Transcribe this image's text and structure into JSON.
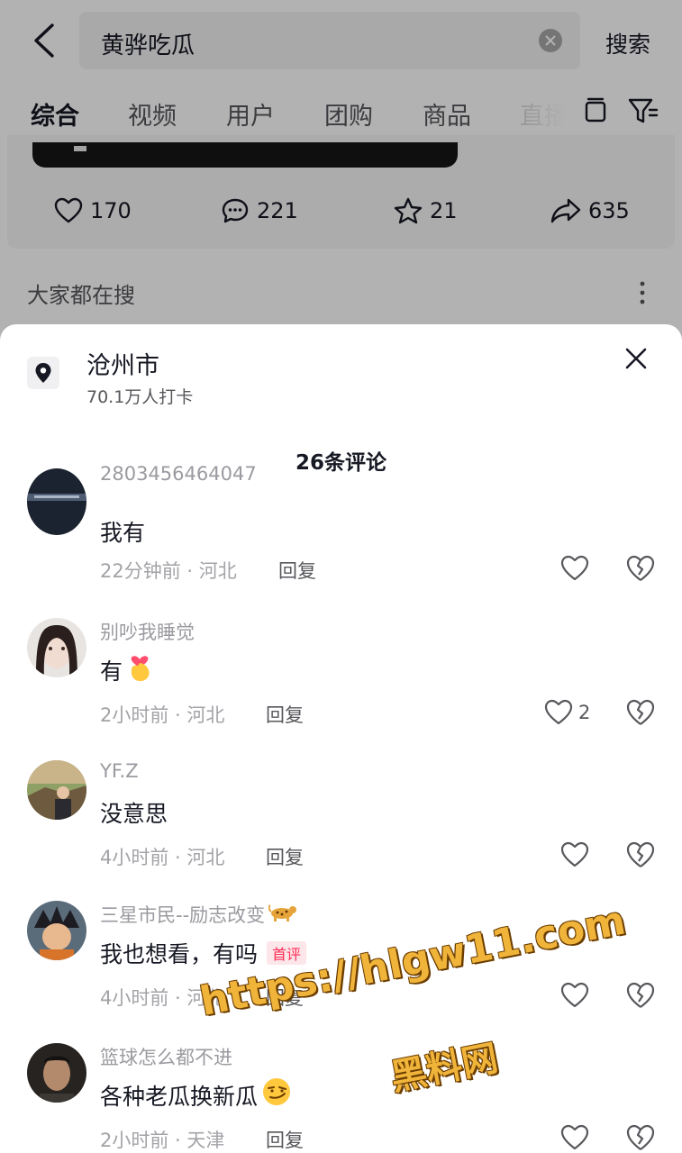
{
  "search": {
    "query": "黄骅吃瓜",
    "submit_label": "搜索"
  },
  "tabs": [
    {
      "label": "综合",
      "active": true
    },
    {
      "label": "视频"
    },
    {
      "label": "用户"
    },
    {
      "label": "团购"
    },
    {
      "label": "商品"
    },
    {
      "label": "直播"
    }
  ],
  "video_stats": {
    "likes": "170",
    "comments": "221",
    "favorites": "21",
    "shares": "635"
  },
  "trending": {
    "title": "大家都在搜"
  },
  "sheet": {
    "location_name": "沧州市",
    "location_checkins": "70.1万人打卡",
    "comment_count_label": "26条评论",
    "reply_label": "回复",
    "first_comment_badge": "首评"
  },
  "comments": [
    {
      "user": "2803456464047",
      "text": "我有",
      "meta": "22分钟前 · 河北",
      "likes": ""
    },
    {
      "user": "别吵我睡觉",
      "text": "有",
      "meta": "2小时前 · 河北",
      "likes": "2"
    },
    {
      "user": "YF.Z",
      "text": "没意思",
      "meta": "4小时前 · 河北",
      "likes": ""
    },
    {
      "user": "三星市民--励志改变",
      "text": "我也想看，有吗",
      "meta": "4小时前 · 河北",
      "likes": ""
    },
    {
      "user": "篮球怎么都不进",
      "text": "各种老瓜换新瓜",
      "meta": "2小时前 · 天津",
      "likes": ""
    }
  ],
  "watermark": {
    "url": "https://hlgw11.com",
    "name": "黑料网"
  },
  "colors": {
    "primary_text": "#161823",
    "secondary_text": "#a3a3a8",
    "badge_red": "#fe2c55",
    "watermark": "#f0b43a"
  }
}
